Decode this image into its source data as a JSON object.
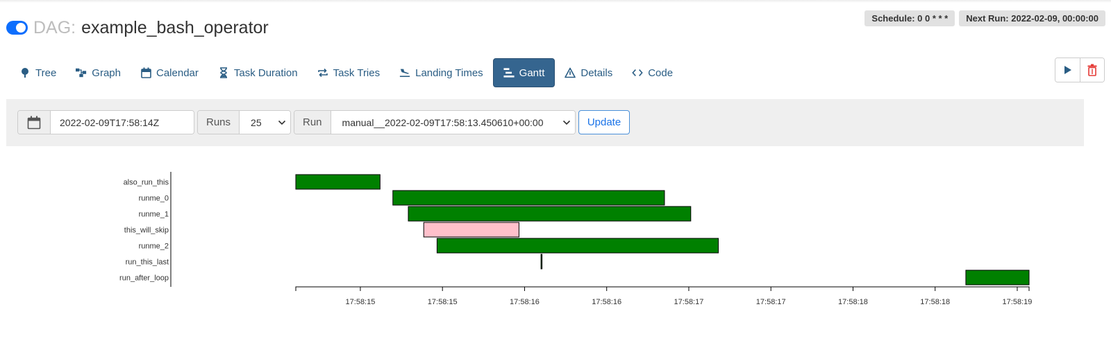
{
  "dag": {
    "prefix": "DAG:",
    "name": "example_bash_operator",
    "paused": false
  },
  "badges": {
    "schedule": "Schedule: 0 0 * * *",
    "next_run": "Next Run: 2022-02-09, 00:00:00"
  },
  "nav": {
    "items": [
      {
        "label": "Tree",
        "icon": "tree-icon"
      },
      {
        "label": "Graph",
        "icon": "graph-icon"
      },
      {
        "label": "Calendar",
        "icon": "calendar-icon"
      },
      {
        "label": "Task Duration",
        "icon": "hourglass-icon"
      },
      {
        "label": "Task Tries",
        "icon": "retry-icon"
      },
      {
        "label": "Landing Times",
        "icon": "plane-landing-icon"
      },
      {
        "label": "Gantt",
        "icon": "gantt-icon",
        "active": true
      },
      {
        "label": "Details",
        "icon": "warning-triangle-icon"
      },
      {
        "label": "Code",
        "icon": "code-icon"
      }
    ]
  },
  "actions": {
    "trigger_icon": "play-icon",
    "delete_icon": "trash-icon"
  },
  "filter": {
    "base_date": "2022-02-09T17:58:14Z",
    "runs_label": "Runs",
    "runs_value": "25",
    "run_label": "Run",
    "run_value": "manual__2022-02-09T17:58:13.450610+00:00",
    "update_label": "Update"
  },
  "colors": {
    "success": "#008000",
    "skipped": "#ffc0cb",
    "active_tab": "#35658f",
    "toggle_on": "#0d6efd"
  },
  "chart_data": {
    "type": "gantt",
    "x_range": [
      "17:58:14.627",
      "17:58:19.092"
    ],
    "tasks": [
      {
        "name": "also_run_this",
        "start": "17:58:14.627",
        "end": "17:58:15.140",
        "state": "success"
      },
      {
        "name": "runme_0",
        "start": "17:58:15.218",
        "end": "17:58:16.872",
        "state": "success"
      },
      {
        "name": "runme_1",
        "start": "17:58:15.312",
        "end": "17:58:17.032",
        "state": "success"
      },
      {
        "name": "this_will_skip",
        "start": "17:58:15.406",
        "end": "17:58:15.986",
        "state": "skipped"
      },
      {
        "name": "runme_2",
        "start": "17:58:15.487",
        "end": "17:58:17.200",
        "state": "success"
      },
      {
        "name": "run_this_last",
        "start": "17:58:16.120",
        "end": "17:58:16.124",
        "state": "success"
      },
      {
        "name": "run_after_loop",
        "start": "17:58:18.707",
        "end": "17:58:19.092",
        "state": "success"
      }
    ],
    "ticks": [
      {
        "t": "17:58:15.020",
        "label": "17:58:15"
      },
      {
        "t": "17:58:15.520",
        "label": "17:58:15"
      },
      {
        "t": "17:58:16.020",
        "label": "17:58:16"
      },
      {
        "t": "17:58:16.520",
        "label": "17:58:16"
      },
      {
        "t": "17:58:17.020",
        "label": "17:58:17"
      },
      {
        "t": "17:58:17.520",
        "label": "17:58:17"
      },
      {
        "t": "17:58:18.020",
        "label": "17:58:18"
      },
      {
        "t": "17:58:18.520",
        "label": "17:58:18"
      },
      {
        "t": "17:58:19.020",
        "label": "17:58:19"
      }
    ]
  }
}
